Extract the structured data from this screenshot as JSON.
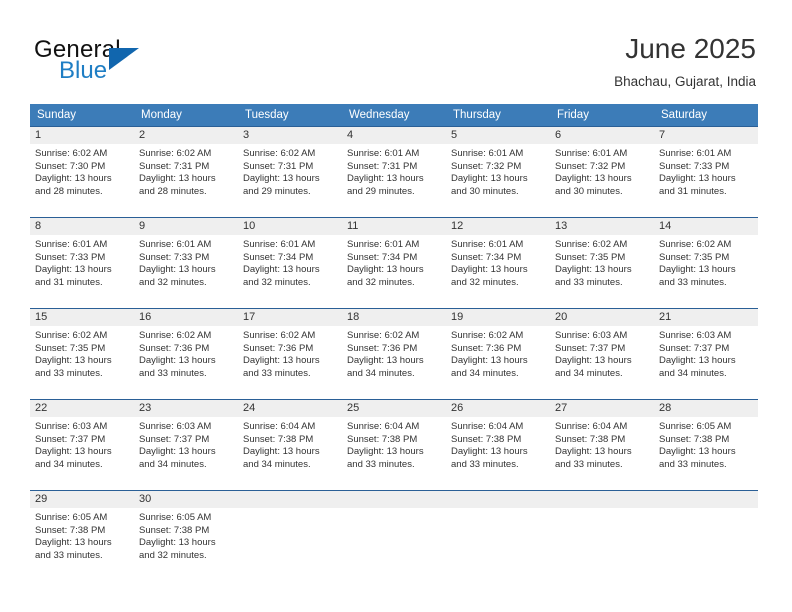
{
  "brand": {
    "name_part1": "General",
    "name_part2": "Blue",
    "logo_icon": "triangle-logo-icon",
    "accent_color": "#1166ae"
  },
  "header": {
    "title": "June 2025",
    "location": "Bhachau, Gujarat, India"
  },
  "theme": {
    "header_row_bg": "#3c7cb8",
    "date_band_bg": "#efefef",
    "cell_border_top": "#2a5f96",
    "text_color": "#333333"
  },
  "weekdays": [
    "Sunday",
    "Monday",
    "Tuesday",
    "Wednesday",
    "Thursday",
    "Friday",
    "Saturday"
  ],
  "weeks": [
    [
      {
        "day": "1",
        "sunrise": "Sunrise: 6:02 AM",
        "sunset": "Sunset: 7:30 PM",
        "daylight1": "Daylight: 13 hours",
        "daylight2": "and 28 minutes."
      },
      {
        "day": "2",
        "sunrise": "Sunrise: 6:02 AM",
        "sunset": "Sunset: 7:31 PM",
        "daylight1": "Daylight: 13 hours",
        "daylight2": "and 28 minutes."
      },
      {
        "day": "3",
        "sunrise": "Sunrise: 6:02 AM",
        "sunset": "Sunset: 7:31 PM",
        "daylight1": "Daylight: 13 hours",
        "daylight2": "and 29 minutes."
      },
      {
        "day": "4",
        "sunrise": "Sunrise: 6:01 AM",
        "sunset": "Sunset: 7:31 PM",
        "daylight1": "Daylight: 13 hours",
        "daylight2": "and 29 minutes."
      },
      {
        "day": "5",
        "sunrise": "Sunrise: 6:01 AM",
        "sunset": "Sunset: 7:32 PM",
        "daylight1": "Daylight: 13 hours",
        "daylight2": "and 30 minutes."
      },
      {
        "day": "6",
        "sunrise": "Sunrise: 6:01 AM",
        "sunset": "Sunset: 7:32 PM",
        "daylight1": "Daylight: 13 hours",
        "daylight2": "and 30 minutes."
      },
      {
        "day": "7",
        "sunrise": "Sunrise: 6:01 AM",
        "sunset": "Sunset: 7:33 PM",
        "daylight1": "Daylight: 13 hours",
        "daylight2": "and 31 minutes."
      }
    ],
    [
      {
        "day": "8",
        "sunrise": "Sunrise: 6:01 AM",
        "sunset": "Sunset: 7:33 PM",
        "daylight1": "Daylight: 13 hours",
        "daylight2": "and 31 minutes."
      },
      {
        "day": "9",
        "sunrise": "Sunrise: 6:01 AM",
        "sunset": "Sunset: 7:33 PM",
        "daylight1": "Daylight: 13 hours",
        "daylight2": "and 32 minutes."
      },
      {
        "day": "10",
        "sunrise": "Sunrise: 6:01 AM",
        "sunset": "Sunset: 7:34 PM",
        "daylight1": "Daylight: 13 hours",
        "daylight2": "and 32 minutes."
      },
      {
        "day": "11",
        "sunrise": "Sunrise: 6:01 AM",
        "sunset": "Sunset: 7:34 PM",
        "daylight1": "Daylight: 13 hours",
        "daylight2": "and 32 minutes."
      },
      {
        "day": "12",
        "sunrise": "Sunrise: 6:01 AM",
        "sunset": "Sunset: 7:34 PM",
        "daylight1": "Daylight: 13 hours",
        "daylight2": "and 32 minutes."
      },
      {
        "day": "13",
        "sunrise": "Sunrise: 6:02 AM",
        "sunset": "Sunset: 7:35 PM",
        "daylight1": "Daylight: 13 hours",
        "daylight2": "and 33 minutes."
      },
      {
        "day": "14",
        "sunrise": "Sunrise: 6:02 AM",
        "sunset": "Sunset: 7:35 PM",
        "daylight1": "Daylight: 13 hours",
        "daylight2": "and 33 minutes."
      }
    ],
    [
      {
        "day": "15",
        "sunrise": "Sunrise: 6:02 AM",
        "sunset": "Sunset: 7:35 PM",
        "daylight1": "Daylight: 13 hours",
        "daylight2": "and 33 minutes."
      },
      {
        "day": "16",
        "sunrise": "Sunrise: 6:02 AM",
        "sunset": "Sunset: 7:36 PM",
        "daylight1": "Daylight: 13 hours",
        "daylight2": "and 33 minutes."
      },
      {
        "day": "17",
        "sunrise": "Sunrise: 6:02 AM",
        "sunset": "Sunset: 7:36 PM",
        "daylight1": "Daylight: 13 hours",
        "daylight2": "and 33 minutes."
      },
      {
        "day": "18",
        "sunrise": "Sunrise: 6:02 AM",
        "sunset": "Sunset: 7:36 PM",
        "daylight1": "Daylight: 13 hours",
        "daylight2": "and 34 minutes."
      },
      {
        "day": "19",
        "sunrise": "Sunrise: 6:02 AM",
        "sunset": "Sunset: 7:36 PM",
        "daylight1": "Daylight: 13 hours",
        "daylight2": "and 34 minutes."
      },
      {
        "day": "20",
        "sunrise": "Sunrise: 6:03 AM",
        "sunset": "Sunset: 7:37 PM",
        "daylight1": "Daylight: 13 hours",
        "daylight2": "and 34 minutes."
      },
      {
        "day": "21",
        "sunrise": "Sunrise: 6:03 AM",
        "sunset": "Sunset: 7:37 PM",
        "daylight1": "Daylight: 13 hours",
        "daylight2": "and 34 minutes."
      }
    ],
    [
      {
        "day": "22",
        "sunrise": "Sunrise: 6:03 AM",
        "sunset": "Sunset: 7:37 PM",
        "daylight1": "Daylight: 13 hours",
        "daylight2": "and 34 minutes."
      },
      {
        "day": "23",
        "sunrise": "Sunrise: 6:03 AM",
        "sunset": "Sunset: 7:37 PM",
        "daylight1": "Daylight: 13 hours",
        "daylight2": "and 34 minutes."
      },
      {
        "day": "24",
        "sunrise": "Sunrise: 6:04 AM",
        "sunset": "Sunset: 7:38 PM",
        "daylight1": "Daylight: 13 hours",
        "daylight2": "and 34 minutes."
      },
      {
        "day": "25",
        "sunrise": "Sunrise: 6:04 AM",
        "sunset": "Sunset: 7:38 PM",
        "daylight1": "Daylight: 13 hours",
        "daylight2": "and 33 minutes."
      },
      {
        "day": "26",
        "sunrise": "Sunrise: 6:04 AM",
        "sunset": "Sunset: 7:38 PM",
        "daylight1": "Daylight: 13 hours",
        "daylight2": "and 33 minutes."
      },
      {
        "day": "27",
        "sunrise": "Sunrise: 6:04 AM",
        "sunset": "Sunset: 7:38 PM",
        "daylight1": "Daylight: 13 hours",
        "daylight2": "and 33 minutes."
      },
      {
        "day": "28",
        "sunrise": "Sunrise: 6:05 AM",
        "sunset": "Sunset: 7:38 PM",
        "daylight1": "Daylight: 13 hours",
        "daylight2": "and 33 minutes."
      }
    ],
    [
      {
        "day": "29",
        "sunrise": "Sunrise: 6:05 AM",
        "sunset": "Sunset: 7:38 PM",
        "daylight1": "Daylight: 13 hours",
        "daylight2": "and 33 minutes."
      },
      {
        "day": "30",
        "sunrise": "Sunrise: 6:05 AM",
        "sunset": "Sunset: 7:38 PM",
        "daylight1": "Daylight: 13 hours",
        "daylight2": "and 32 minutes."
      },
      {
        "day": "",
        "sunrise": "",
        "sunset": "",
        "daylight1": "",
        "daylight2": ""
      },
      {
        "day": "",
        "sunrise": "",
        "sunset": "",
        "daylight1": "",
        "daylight2": ""
      },
      {
        "day": "",
        "sunrise": "",
        "sunset": "",
        "daylight1": "",
        "daylight2": ""
      },
      {
        "day": "",
        "sunrise": "",
        "sunset": "",
        "daylight1": "",
        "daylight2": ""
      },
      {
        "day": "",
        "sunrise": "",
        "sunset": "",
        "daylight1": "",
        "daylight2": ""
      }
    ]
  ]
}
